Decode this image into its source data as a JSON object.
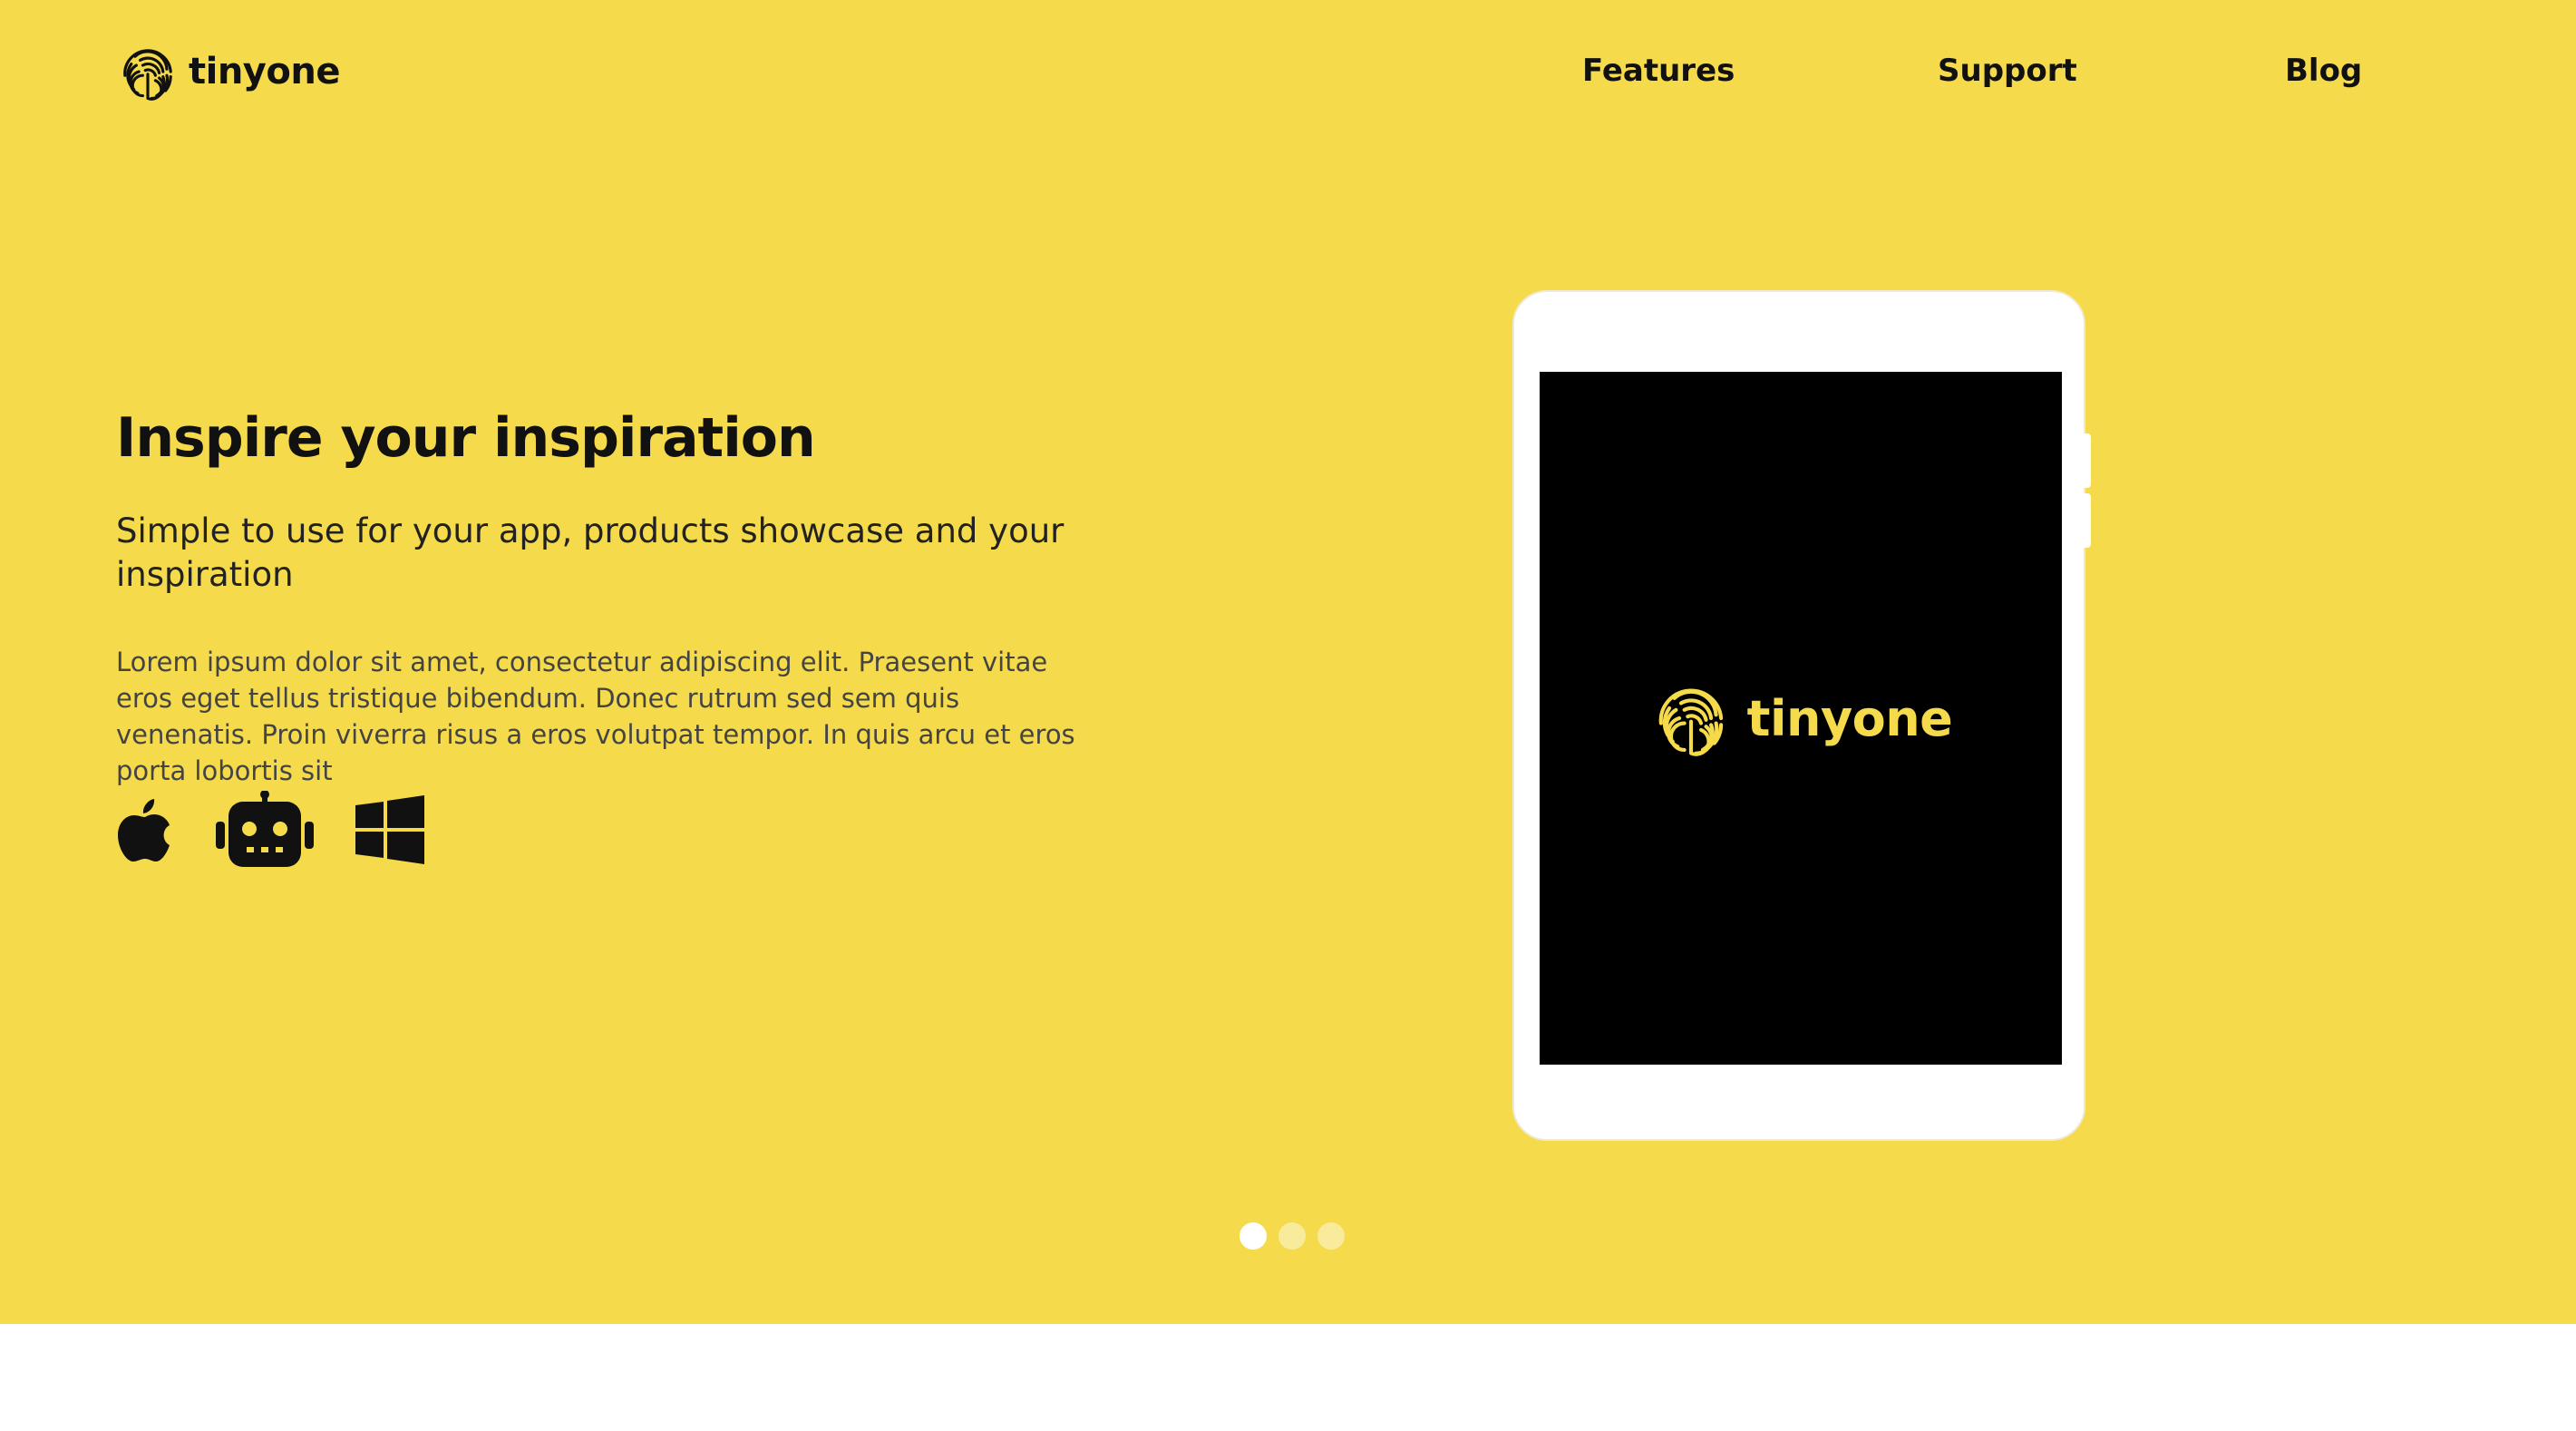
{
  "brand": {
    "name": "tinyone",
    "accent_color": "#f5db4b",
    "logo_icon": "fingerprint-icon"
  },
  "nav": {
    "items": [
      {
        "label": "Features"
      },
      {
        "label": "Support"
      },
      {
        "label": "Blog"
      }
    ]
  },
  "hero": {
    "title": "Inspire your inspiration",
    "subtitle": "Simple to use for your app, products showcase and your inspiration",
    "body": "Lorem ipsum dolor sit amet, consectetur adipiscing elit. Praesent vitae eros eget tellus tristique bibendum. Donec rutrum sed sem quis venenatis. Proin viverra risus a eros volutpat tempor. In quis arcu et eros porta lobortis sit",
    "platforms": [
      "apple-icon",
      "android-robot-icon",
      "windows-icon"
    ]
  },
  "device": {
    "screen_brand": "tinyone",
    "screen_background": "#000000"
  },
  "carousel": {
    "slide_count": 3,
    "active_index": 0
  }
}
